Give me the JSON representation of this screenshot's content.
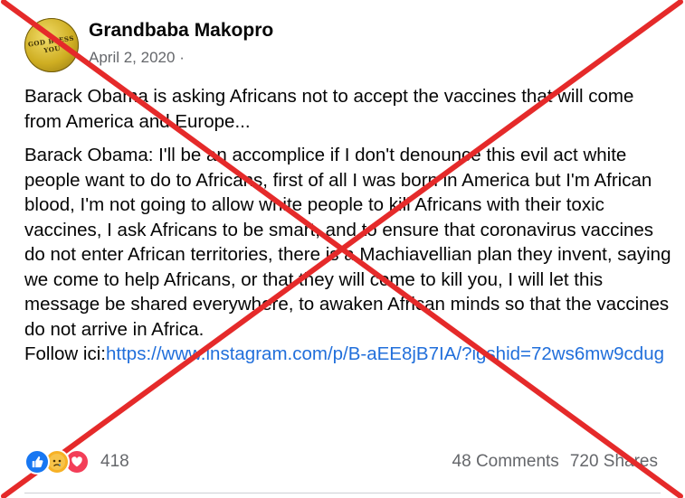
{
  "post": {
    "author": "Grandbaba Makopro",
    "avatar_text": "GOD BLESS YOU",
    "date": "April 2, 2020",
    "separator": "·",
    "paragraph1": "Barack Obama is asking Africans not to accept the vaccines that will come from America and Europe...",
    "paragraph2": "Barack Obama: I'll be an accomplice if I don't denounce this evil act white people want to do to Africans, first of all I was born in America but I'm African blood, I'm not going to allow white people to kill Africans with their toxic vaccines, I ask Africans to be smart, and to ensure that coronavirus vaccines do not enter African territories, there is a Machiavellian plan they invent, saying we come to help Africans, or that they will come to kill you, I will let this message be shared everywhere, to awaken African minds so that the vaccines do not arrive in Africa.",
    "follow_prefix": "Follow ici:",
    "link": "https://www.instagram.com/p/B-aEE8jB7IA/?igshid=72ws6mw9cdug"
  },
  "reactions": {
    "icons": [
      "like-icon",
      "sad-icon",
      "love-icon"
    ],
    "count": "418"
  },
  "stats": {
    "comments": "48 Comments",
    "shares": "720 Shares"
  },
  "colors": {
    "cross": "#e52a2a",
    "link": "#216fdb",
    "meta": "#65676b"
  }
}
